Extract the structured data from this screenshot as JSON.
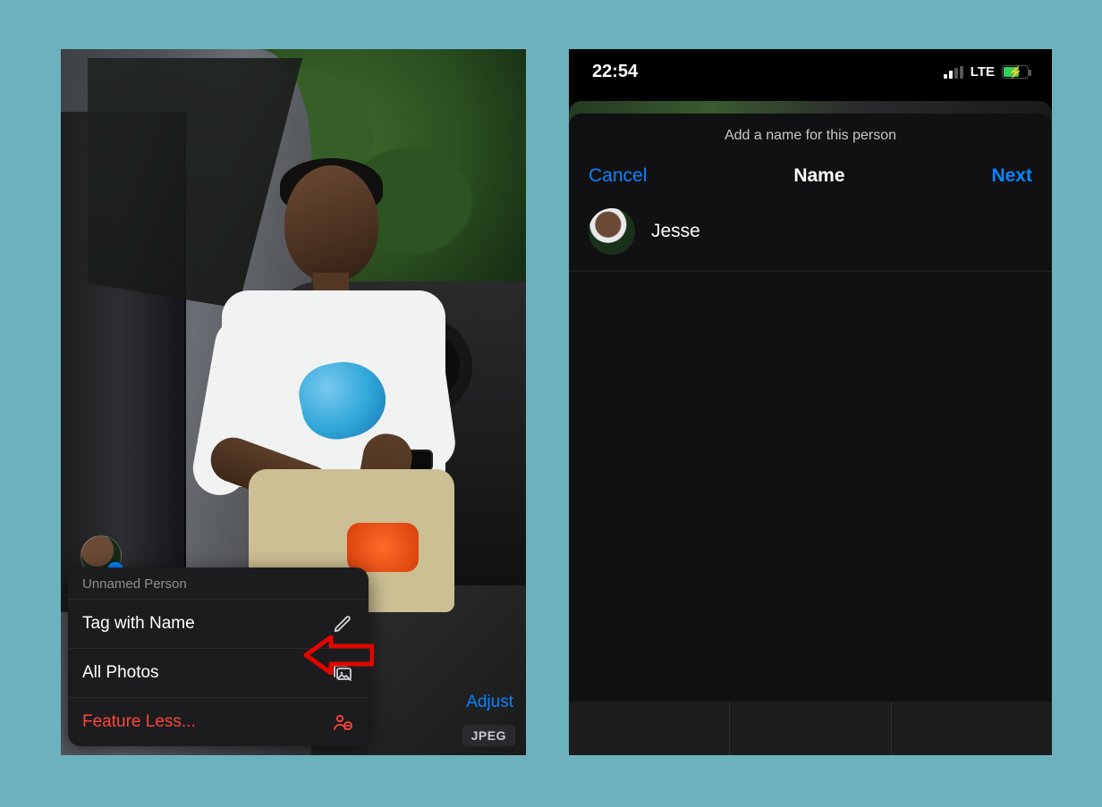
{
  "left": {
    "menu_header": "Unnamed Person",
    "menu": {
      "tag": "Tag with Name",
      "all_photos": "All Photos",
      "feature_less": "Feature Less..."
    },
    "adjust": "Adjust",
    "badge": "JPEG",
    "face_chip_badge": "?"
  },
  "right": {
    "status": {
      "time": "22:54",
      "network": "LTE"
    },
    "sheet_title": "Add a name for this person",
    "nav": {
      "cancel": "Cancel",
      "title": "Name",
      "next": "Next"
    },
    "name_value": "Jesse"
  }
}
